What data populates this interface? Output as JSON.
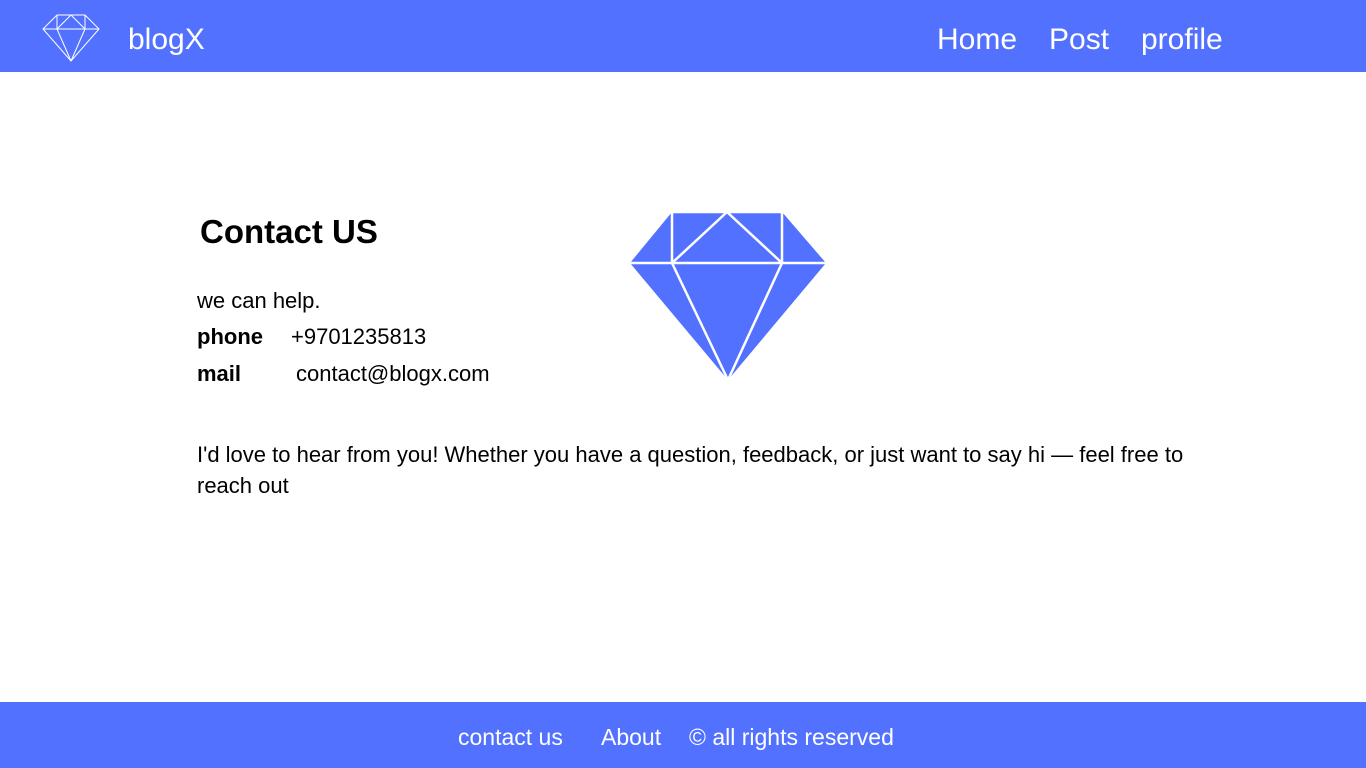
{
  "header": {
    "brand": "blogX",
    "logo_icon": "diamond-outline-icon",
    "nav": [
      "Home",
      "Post",
      "profile"
    ]
  },
  "main": {
    "title": "Contact US",
    "intro": "we can help.",
    "phone_label": "phone",
    "phone_value": "+9701235813",
    "mail_label": "mail",
    "mail_value": "contact@blogx.com",
    "message": "I'd love to hear from you! Whether you have a question, feedback, or just want to say hi — feel free to reach out",
    "illustration": "diamond-icon"
  },
  "footer": {
    "items": [
      "contact us",
      "About",
      "© all rights reserved"
    ]
  },
  "colors": {
    "accent": "#5271ff",
    "text": "#000000",
    "background": "#ffffff"
  }
}
